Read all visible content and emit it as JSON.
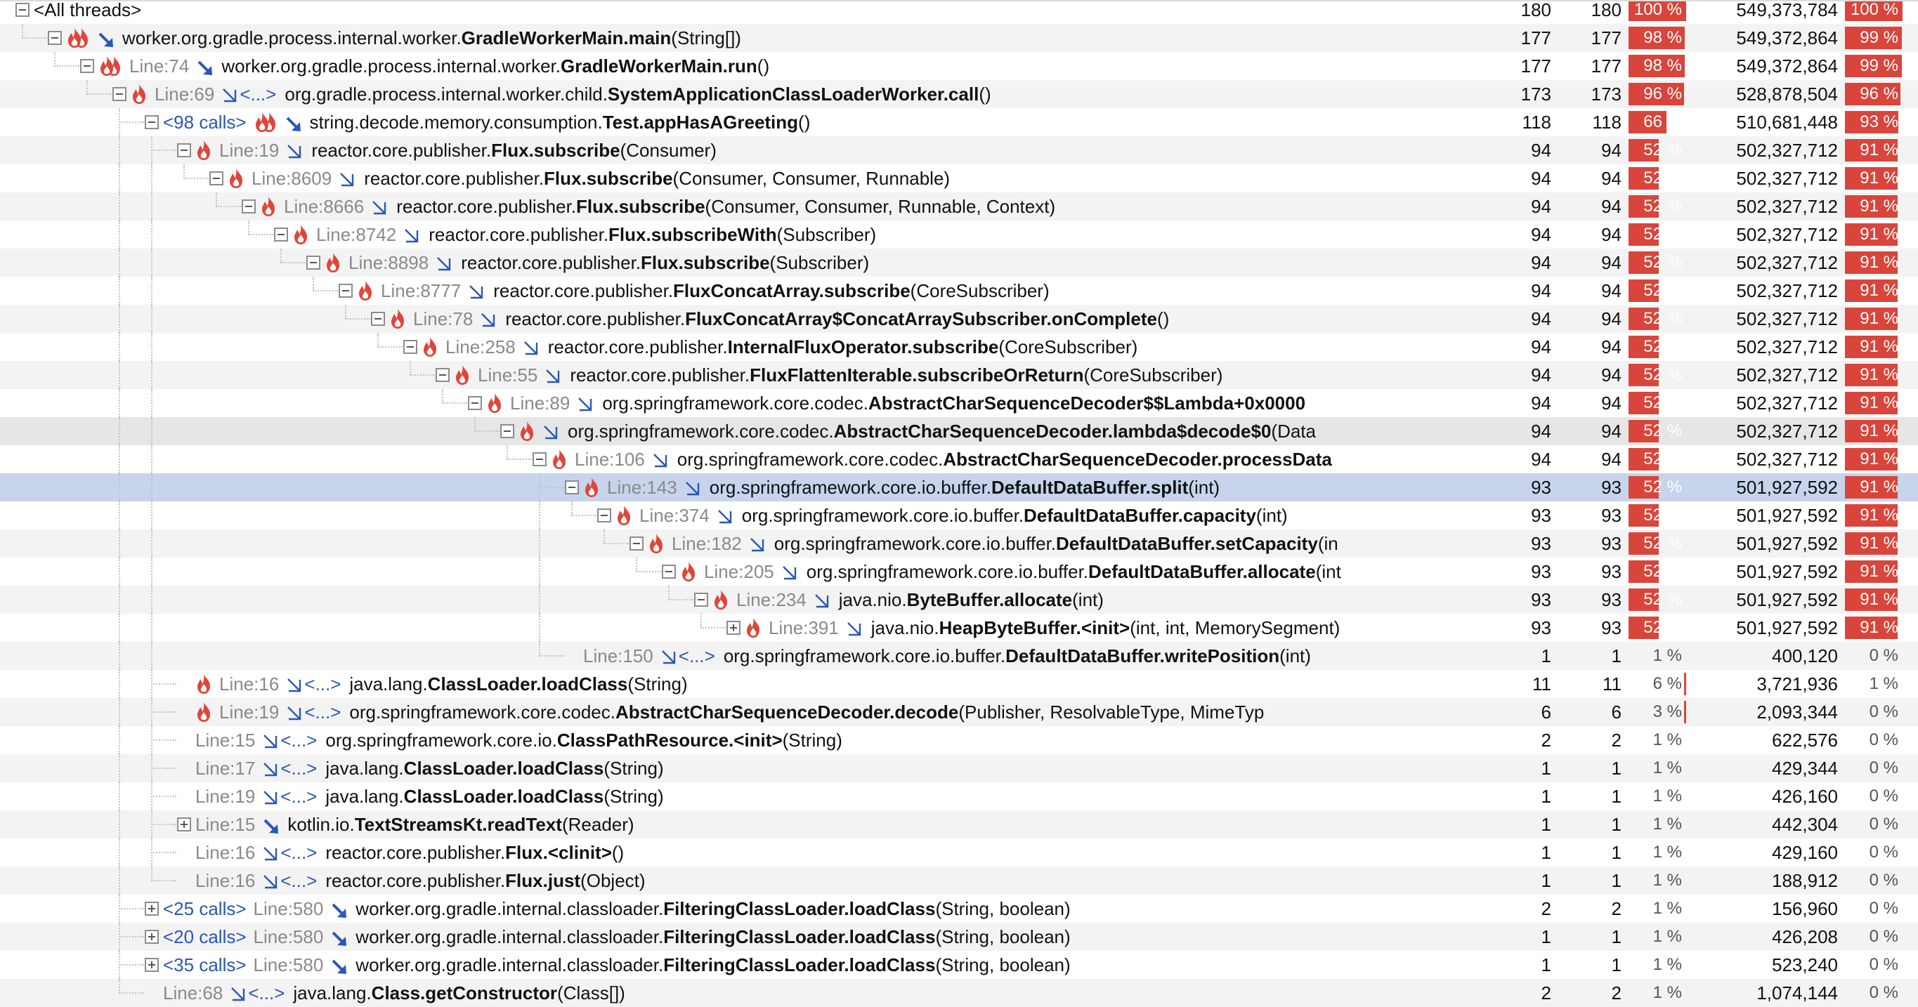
{
  "colors": {
    "bar": "#d9453b",
    "selected_row": "#c6d4ec",
    "link_blue": "#2a57b8",
    "line_gray": "#8a8a8a"
  },
  "rows": [
    {
      "level": 0,
      "toggle": "minus",
      "flame": "none",
      "calls": "",
      "line": "",
      "arrow": "none",
      "ellipsis": "",
      "pkg": "",
      "cls": "",
      "sig": "<All threads>",
      "c1": "180",
      "c2": "180",
      "p1": "100 %",
      "f1": 1.0,
      "c4": "549,373,784",
      "p2": "100 %",
      "f2": 1.0
    },
    {
      "level": 1,
      "toggle": "minus",
      "flame": "double",
      "calls": "",
      "line": "",
      "arrow": "direct",
      "ellipsis": "",
      "pkg": "worker.org.gradle.process.internal.worker.",
      "cls": "GradleWorkerMain.main",
      "sig": "(String[])",
      "c1": "177",
      "c2": "177",
      "p1": "98 %",
      "f1": 0.98,
      "c4": "549,372,864",
      "p2": "99 %",
      "f2": 0.99
    },
    {
      "level": 2,
      "toggle": "minus",
      "flame": "double",
      "calls": "",
      "line": "Line:74",
      "arrow": "direct",
      "ellipsis": "",
      "pkg": "worker.org.gradle.process.internal.worker.",
      "cls": "GradleWorkerMain.run",
      "sig": "()",
      "c1": "177",
      "c2": "177",
      "p1": "98 %",
      "f1": 0.98,
      "c4": "549,372,864",
      "p2": "99 %",
      "f2": 0.99
    },
    {
      "level": 3,
      "toggle": "minus",
      "flame": "single",
      "calls": "",
      "line": "Line:69",
      "arrow": "indirect",
      "ellipsis": "<...>",
      "pkg": "org.gradle.process.internal.worker.child.",
      "cls": "SystemApplicationClassLoaderWorker.call",
      "sig": "()",
      "c1": "173",
      "c2": "173",
      "p1": "96 %",
      "f1": 0.96,
      "c4": "528,878,504",
      "p2": "96 %",
      "f2": 0.96
    },
    {
      "level": 4,
      "toggle": "minus",
      "flame": "double",
      "calls": "<98 calls>",
      "line": "",
      "arrow": "direct",
      "ellipsis": "",
      "pkg": "string.decode.memory.consumption.",
      "cls": "Test.appHasAGreeting",
      "sig": "()",
      "c1": "118",
      "c2": "118",
      "p1": "66 %",
      "f1": 0.66,
      "c4": "510,681,448",
      "p2": "93 %",
      "f2": 0.93
    },
    {
      "level": 5,
      "toggle": "minus",
      "flame": "single",
      "calls": "",
      "line": "Line:19",
      "arrow": "indirect",
      "ellipsis": "",
      "pkg": "reactor.core.publisher.",
      "cls": "Flux.subscribe",
      "sig": "(Consumer)",
      "c1": "94",
      "c2": "94",
      "p1": "52 %",
      "f1": 0.52,
      "c4": "502,327,712",
      "p2": "91 %",
      "f2": 0.91
    },
    {
      "level": 6,
      "toggle": "minus",
      "flame": "single",
      "calls": "",
      "line": "Line:8609",
      "arrow": "indirect",
      "ellipsis": "",
      "pkg": "reactor.core.publisher.",
      "cls": "Flux.subscribe",
      "sig": "(Consumer, Consumer, Runnable)",
      "c1": "94",
      "c2": "94",
      "p1": "52 %",
      "f1": 0.52,
      "c4": "502,327,712",
      "p2": "91 %",
      "f2": 0.91
    },
    {
      "level": 7,
      "toggle": "minus",
      "flame": "single",
      "calls": "",
      "line": "Line:8666",
      "arrow": "indirect",
      "ellipsis": "",
      "pkg": "reactor.core.publisher.",
      "cls": "Flux.subscribe",
      "sig": "(Consumer, Consumer, Runnable, Context)",
      "c1": "94",
      "c2": "94",
      "p1": "52 %",
      "f1": 0.52,
      "c4": "502,327,712",
      "p2": "91 %",
      "f2": 0.91
    },
    {
      "level": 8,
      "toggle": "minus",
      "flame": "single",
      "calls": "",
      "line": "Line:8742",
      "arrow": "indirect",
      "ellipsis": "",
      "pkg": "reactor.core.publisher.",
      "cls": "Flux.subscribeWith",
      "sig": "(Subscriber)",
      "c1": "94",
      "c2": "94",
      "p1": "52 %",
      "f1": 0.52,
      "c4": "502,327,712",
      "p2": "91 %",
      "f2": 0.91
    },
    {
      "level": 9,
      "toggle": "minus",
      "flame": "single",
      "calls": "",
      "line": "Line:8898",
      "arrow": "indirect",
      "ellipsis": "",
      "pkg": "reactor.core.publisher.",
      "cls": "Flux.subscribe",
      "sig": "(Subscriber)",
      "c1": "94",
      "c2": "94",
      "p1": "52 %",
      "f1": 0.52,
      "c4": "502,327,712",
      "p2": "91 %",
      "f2": 0.91
    },
    {
      "level": 10,
      "toggle": "minus",
      "flame": "single",
      "calls": "",
      "line": "Line:8777",
      "arrow": "indirect",
      "ellipsis": "",
      "pkg": "reactor.core.publisher.",
      "cls": "FluxConcatArray.subscribe",
      "sig": "(CoreSubscriber)",
      "c1": "94",
      "c2": "94",
      "p1": "52 %",
      "f1": 0.52,
      "c4": "502,327,712",
      "p2": "91 %",
      "f2": 0.91
    },
    {
      "level": 11,
      "toggle": "minus",
      "flame": "single",
      "calls": "",
      "line": "Line:78",
      "arrow": "indirect",
      "ellipsis": "",
      "pkg": "reactor.core.publisher.",
      "cls": "FluxConcatArray$ConcatArraySubscriber.onComplete",
      "sig": "()",
      "c1": "94",
      "c2": "94",
      "p1": "52 %",
      "f1": 0.52,
      "c4": "502,327,712",
      "p2": "91 %",
      "f2": 0.91
    },
    {
      "level": 12,
      "toggle": "minus",
      "flame": "single",
      "calls": "",
      "line": "Line:258",
      "arrow": "indirect",
      "ellipsis": "",
      "pkg": "reactor.core.publisher.",
      "cls": "InternalFluxOperator.subscribe",
      "sig": "(CoreSubscriber)",
      "c1": "94",
      "c2": "94",
      "p1": "52 %",
      "f1": 0.52,
      "c4": "502,327,712",
      "p2": "91 %",
      "f2": 0.91
    },
    {
      "level": 13,
      "toggle": "minus",
      "flame": "single",
      "calls": "",
      "line": "Line:55",
      "arrow": "indirect",
      "ellipsis": "",
      "pkg": "reactor.core.publisher.",
      "cls": "FluxFlattenIterable.subscribeOrReturn",
      "sig": "(CoreSubscriber)",
      "c1": "94",
      "c2": "94",
      "p1": "52 %",
      "f1": 0.52,
      "c4": "502,327,712",
      "p2": "91 %",
      "f2": 0.91
    },
    {
      "level": 14,
      "toggle": "minus",
      "flame": "single",
      "calls": "",
      "line": "Line:89",
      "arrow": "indirect",
      "ellipsis": "",
      "pkg": "org.springframework.core.codec.",
      "cls": "AbstractCharSequenceDecoder$$Lambda+0x0000",
      "sig": "",
      "c1": "94",
      "c2": "94",
      "p1": "52 %",
      "f1": 0.52,
      "c4": "502,327,712",
      "p2": "91 %",
      "f2": 0.91
    },
    {
      "level": 15,
      "toggle": "minus",
      "flame": "single",
      "calls": "",
      "line": "",
      "arrow": "indirect",
      "ellipsis": "",
      "pkg": "org.springframework.core.codec.",
      "cls": "AbstractCharSequenceDecoder.lambda$decode$0",
      "sig": "(Data",
      "c1": "94",
      "c2": "94",
      "p1": "52 %",
      "f1": 0.52,
      "c4": "502,327,712",
      "p2": "91 %",
      "f2": 0.91,
      "hover": true
    },
    {
      "level": 16,
      "toggle": "minus",
      "flame": "single",
      "calls": "",
      "line": "Line:106",
      "arrow": "indirect",
      "ellipsis": "",
      "pkg": "org.springframework.core.codec.",
      "cls": "AbstractCharSequenceDecoder.processData",
      "sig": "",
      "c1": "94",
      "c2": "94",
      "p1": "52 %",
      "f1": 0.52,
      "c4": "502,327,712",
      "p2": "91 %",
      "f2": 0.91
    },
    {
      "level": 17,
      "toggle": "minus",
      "flame": "single",
      "calls": "",
      "line": "Line:143",
      "arrow": "indirect",
      "ellipsis": "",
      "pkg": "org.springframework.core.io.buffer.",
      "cls": "DefaultDataBuffer.split",
      "sig": "(int)",
      "c1": "93",
      "c2": "93",
      "p1": "52 %",
      "f1": 0.52,
      "c4": "501,927,592",
      "p2": "91 %",
      "f2": 0.91,
      "selected": true
    },
    {
      "level": 18,
      "toggle": "minus",
      "flame": "single",
      "calls": "",
      "line": "Line:374",
      "arrow": "indirect",
      "ellipsis": "",
      "pkg": "org.springframework.core.io.buffer.",
      "cls": "DefaultDataBuffer.capacity",
      "sig": "(int)",
      "c1": "93",
      "c2": "93",
      "p1": "52 %",
      "f1": 0.52,
      "c4": "501,927,592",
      "p2": "91 %",
      "f2": 0.91
    },
    {
      "level": 19,
      "toggle": "minus",
      "flame": "single",
      "calls": "",
      "line": "Line:182",
      "arrow": "indirect",
      "ellipsis": "",
      "pkg": "org.springframework.core.io.buffer.",
      "cls": "DefaultDataBuffer.setCapacity",
      "sig": "(in",
      "c1": "93",
      "c2": "93",
      "p1": "52 %",
      "f1": 0.52,
      "c4": "501,927,592",
      "p2": "91 %",
      "f2": 0.91
    },
    {
      "level": 20,
      "toggle": "minus",
      "flame": "single",
      "calls": "",
      "line": "Line:205",
      "arrow": "indirect",
      "ellipsis": "",
      "pkg": "org.springframework.core.io.buffer.",
      "cls": "DefaultDataBuffer.allocate",
      "sig": "(int",
      "c1": "93",
      "c2": "93",
      "p1": "52 %",
      "f1": 0.52,
      "c4": "501,927,592",
      "p2": "91 %",
      "f2": 0.91
    },
    {
      "level": 21,
      "toggle": "minus",
      "flame": "single",
      "calls": "",
      "line": "Line:234",
      "arrow": "indirect",
      "ellipsis": "",
      "pkg": "java.nio.",
      "cls": "ByteBuffer.allocate",
      "sig": "(int)",
      "c1": "93",
      "c2": "93",
      "p1": "52 %",
      "f1": 0.52,
      "c4": "501,927,592",
      "p2": "91 %",
      "f2": 0.91
    },
    {
      "level": 22,
      "toggle": "plus",
      "flame": "single",
      "calls": "",
      "line": "Line:391",
      "arrow": "indirect",
      "ellipsis": "",
      "pkg": "java.nio.",
      "cls": "HeapByteBuffer.<init>",
      "sig": "(int, int, MemorySegment)",
      "c1": "93",
      "c2": "93",
      "p1": "52 %",
      "f1": 0.52,
      "c4": "501,927,592",
      "p2": "91 %",
      "f2": 0.91
    },
    {
      "level": 17,
      "toggle": "none",
      "flame": "none",
      "calls": "",
      "line": "Line:150",
      "arrow": "indirect",
      "ellipsis": "<...>",
      "pkg": "org.springframework.core.io.buffer.",
      "cls": "DefaultDataBuffer.writePosition",
      "sig": "(int)",
      "c1": "1",
      "c2": "1",
      "p1": "1 %",
      "f1": 0.0,
      "c4": "400,120",
      "p2": "0 %",
      "f2": 0.0
    },
    {
      "level": 5,
      "toggle": "none",
      "flame": "single",
      "calls": "",
      "line": "Line:16",
      "arrow": "indirect",
      "ellipsis": "<...>",
      "pkg": "java.lang.",
      "cls": "ClassLoader.loadClass",
      "sig": "(String)",
      "c1": "11",
      "c2": "11",
      "p1": "6 %",
      "f1": 0.02,
      "c4": "3,721,936",
      "p2": "1 %",
      "f2": 0.0
    },
    {
      "level": 5,
      "toggle": "none",
      "flame": "single",
      "calls": "",
      "line": "Line:19",
      "arrow": "indirect",
      "ellipsis": "<...>",
      "pkg": "org.springframework.core.codec.",
      "cls": "AbstractCharSequenceDecoder.decode",
      "sig": "(Publisher, ResolvableType, MimeTyp",
      "c1": "6",
      "c2": "6",
      "p1": "3 %",
      "f1": 0.01,
      "c4": "2,093,344",
      "p2": "0 %",
      "f2": 0.0
    },
    {
      "level": 5,
      "toggle": "none",
      "flame": "none",
      "calls": "",
      "line": "Line:15",
      "arrow": "indirect",
      "ellipsis": "<...>",
      "pkg": "org.springframework.core.io.",
      "cls": "ClassPathResource.<init>",
      "sig": "(String)",
      "c1": "2",
      "c2": "2",
      "p1": "1 %",
      "f1": 0.0,
      "c4": "622,576",
      "p2": "0 %",
      "f2": 0.0
    },
    {
      "level": 5,
      "toggle": "none",
      "flame": "none",
      "calls": "",
      "line": "Line:17",
      "arrow": "indirect",
      "ellipsis": "<...>",
      "pkg": "java.lang.",
      "cls": "ClassLoader.loadClass",
      "sig": "(String)",
      "c1": "1",
      "c2": "1",
      "p1": "1 %",
      "f1": 0.0,
      "c4": "429,344",
      "p2": "0 %",
      "f2": 0.0
    },
    {
      "level": 5,
      "toggle": "none",
      "flame": "none",
      "calls": "",
      "line": "Line:19",
      "arrow": "indirect",
      "ellipsis": "<...>",
      "pkg": "java.lang.",
      "cls": "ClassLoader.loadClass",
      "sig": "(String)",
      "c1": "1",
      "c2": "1",
      "p1": "1 %",
      "f1": 0.0,
      "c4": "426,160",
      "p2": "0 %",
      "f2": 0.0
    },
    {
      "level": 5,
      "toggle": "plus",
      "flame": "none",
      "calls": "",
      "line": "Line:15",
      "arrow": "direct",
      "ellipsis": "",
      "pkg": "kotlin.io.",
      "cls": "TextStreamsKt.readText",
      "sig": "(Reader)",
      "c1": "1",
      "c2": "1",
      "p1": "1 %",
      "f1": 0.0,
      "c4": "442,304",
      "p2": "0 %",
      "f2": 0.0
    },
    {
      "level": 5,
      "toggle": "none",
      "flame": "none",
      "calls": "",
      "line": "Line:16",
      "arrow": "indirect",
      "ellipsis": "<...>",
      "pkg": "reactor.core.publisher.",
      "cls": "Flux.<clinit>",
      "sig": "()",
      "c1": "1",
      "c2": "1",
      "p1": "1 %",
      "f1": 0.0,
      "c4": "429,160",
      "p2": "0 %",
      "f2": 0.0
    },
    {
      "level": 5,
      "toggle": "none",
      "flame": "none",
      "calls": "",
      "line": "Line:16",
      "arrow": "indirect",
      "ellipsis": "<...>",
      "pkg": "reactor.core.publisher.",
      "cls": "Flux.just",
      "sig": "(Object)",
      "c1": "1",
      "c2": "1",
      "p1": "1 %",
      "f1": 0.0,
      "c4": "188,912",
      "p2": "0 %",
      "f2": 0.0
    },
    {
      "level": 4,
      "toggle": "plus",
      "flame": "none",
      "calls": "<25 calls>",
      "line": "Line:580",
      "arrow": "direct",
      "ellipsis": "",
      "pkg": "worker.org.gradle.internal.classloader.",
      "cls": "FilteringClassLoader.loadClass",
      "sig": "(String, boolean)",
      "c1": "2",
      "c2": "2",
      "p1": "1 %",
      "f1": 0.0,
      "c4": "156,960",
      "p2": "0 %",
      "f2": 0.0
    },
    {
      "level": 4,
      "toggle": "plus",
      "flame": "none",
      "calls": "<20 calls>",
      "line": "Line:580",
      "arrow": "direct",
      "ellipsis": "",
      "pkg": "worker.org.gradle.internal.classloader.",
      "cls": "FilteringClassLoader.loadClass",
      "sig": "(String, boolean)",
      "c1": "1",
      "c2": "1",
      "p1": "1 %",
      "f1": 0.0,
      "c4": "426,208",
      "p2": "0 %",
      "f2": 0.0
    },
    {
      "level": 4,
      "toggle": "plus",
      "flame": "none",
      "calls": "<35 calls>",
      "line": "Line:580",
      "arrow": "direct",
      "ellipsis": "",
      "pkg": "worker.org.gradle.internal.classloader.",
      "cls": "FilteringClassLoader.loadClass",
      "sig": "(String, boolean)",
      "c1": "1",
      "c2": "1",
      "p1": "1 %",
      "f1": 0.0,
      "c4": "523,240",
      "p2": "0 %",
      "f2": 0.0
    },
    {
      "level": 4,
      "toggle": "none",
      "flame": "none",
      "calls": "",
      "line": "Line:68",
      "arrow": "indirect",
      "ellipsis": "<...>",
      "pkg": "java.lang.",
      "cls": "Class.getConstructor",
      "sig": "(Class[])",
      "c1": "2",
      "c2": "2",
      "p1": "1 %",
      "f1": 0.0,
      "c4": "1,074,144",
      "p2": "0 %",
      "f2": 0.0
    }
  ]
}
